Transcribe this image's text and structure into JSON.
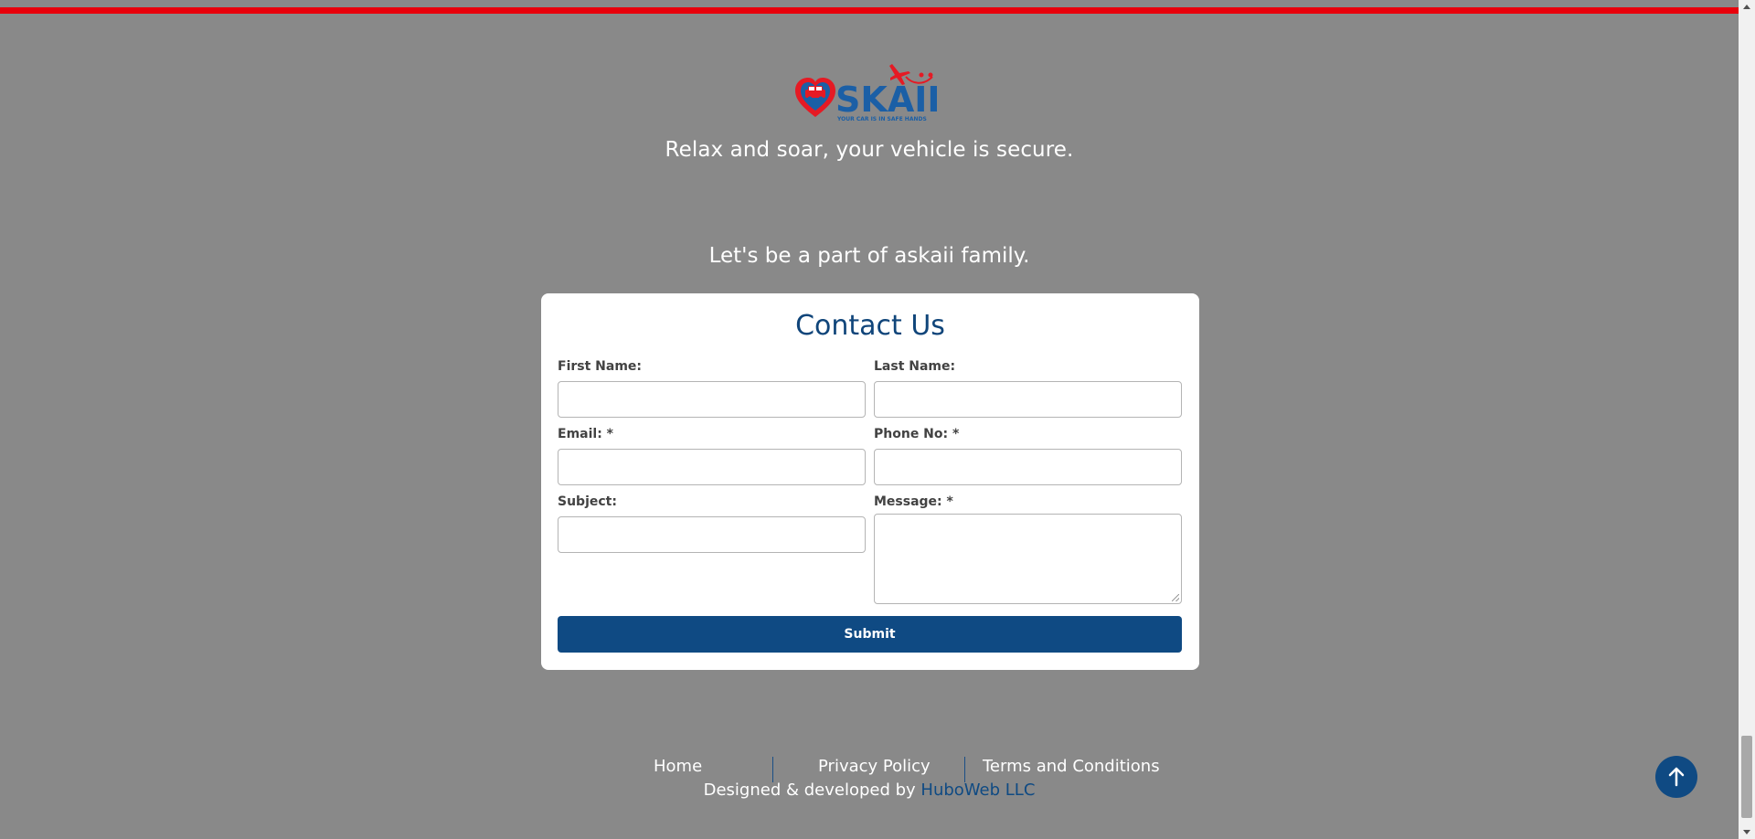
{
  "brand": {
    "logo_text": "SKAII",
    "logo_slogan": "YOUR CAR IS IN SAFE HANDS",
    "tagline": "Relax and soar, your vehicle is secure."
  },
  "invite_text": "Let's be a part of askaii family.",
  "contact_form": {
    "title": "Contact Us",
    "fields": {
      "first_name": {
        "label": "First Name:",
        "value": ""
      },
      "last_name": {
        "label": "Last Name:",
        "value": ""
      },
      "email": {
        "label": "Email: *",
        "value": ""
      },
      "phone": {
        "label": "Phone No: *",
        "value": ""
      },
      "subject": {
        "label": "Subject:",
        "value": ""
      },
      "message": {
        "label": "Message: *",
        "value": ""
      }
    },
    "submit_label": "Submit"
  },
  "footer": {
    "links": [
      "Home",
      "Privacy Policy",
      "Terms and Conditions"
    ],
    "credits_prefix": "Designed & developed by",
    "credits_company": "HuboWeb LLC"
  },
  "colors": {
    "accent_red": "#e8000b",
    "primary_blue": "#0f4a83",
    "page_background": "#898989"
  },
  "icons": {
    "to_top": "arrow-up-icon",
    "logo_heart": "heart-car-icon",
    "logo_plane": "airplane-icon"
  }
}
